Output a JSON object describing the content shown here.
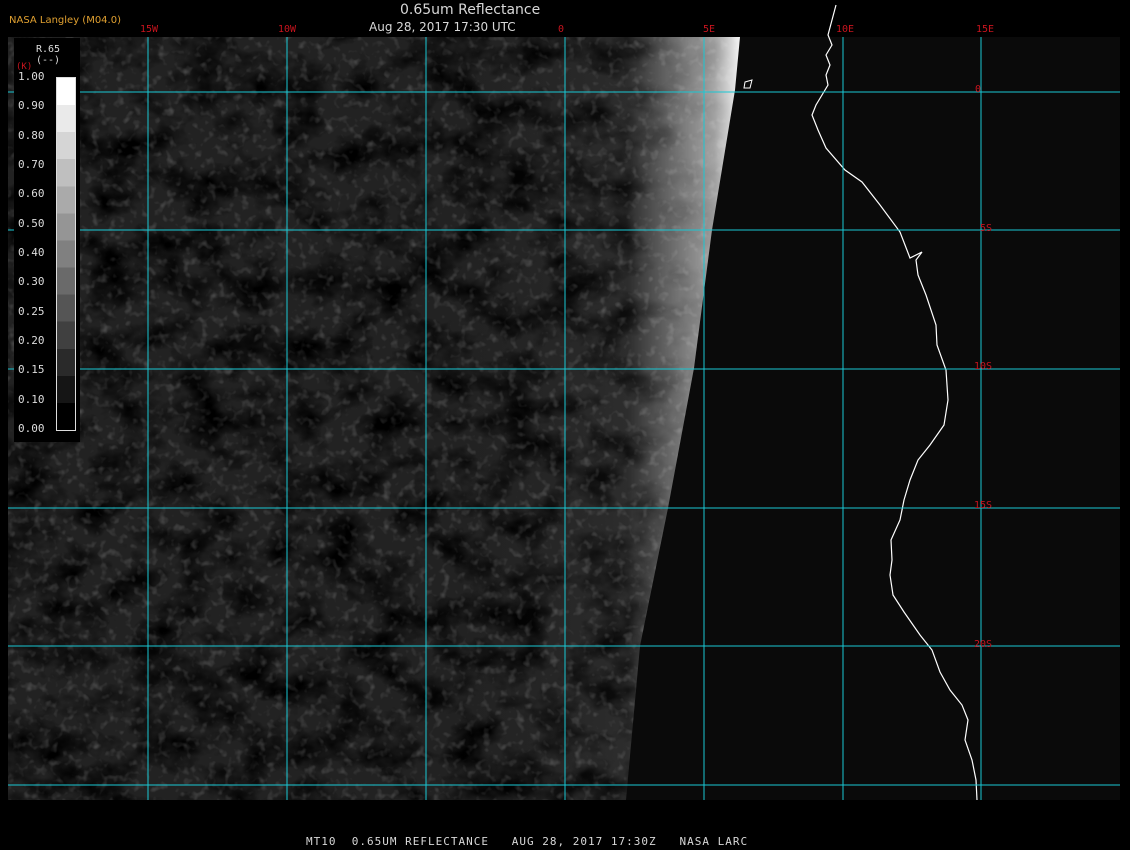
{
  "header": {
    "credit": "NASA Langley (M04.0)",
    "title": "0.65um Reflectance",
    "timestamp": "Aug 28, 2017 17:30 UTC"
  },
  "footer": {
    "caption": "MT10  0.65UM REFLECTANCE   AUG 28, 2017 17:30Z   NASA LARC"
  },
  "legend": {
    "title": "R.65",
    "unit": "(--)",
    "unit_marker": "(K)",
    "ticks": [
      "1.00",
      "0.90",
      "0.80",
      "0.70",
      "0.60",
      "0.50",
      "0.40",
      "0.30",
      "0.25",
      "0.20",
      "0.15",
      "0.10",
      "0.00"
    ],
    "bar_top_color": "#ffffff",
    "bar_bottom_color": "#000000"
  },
  "grid": {
    "longitude_labels": [
      "15W",
      "10W",
      "0",
      "5E",
      "10E",
      "15E"
    ],
    "latitude_labels": [
      "0",
      "5S",
      "10S",
      "15S",
      "20S"
    ],
    "color": "#19c8d4",
    "label_color": "#c8141e"
  },
  "map": {
    "coastline_color": "#ffffff",
    "ocean_color": "#0a0a0a"
  }
}
